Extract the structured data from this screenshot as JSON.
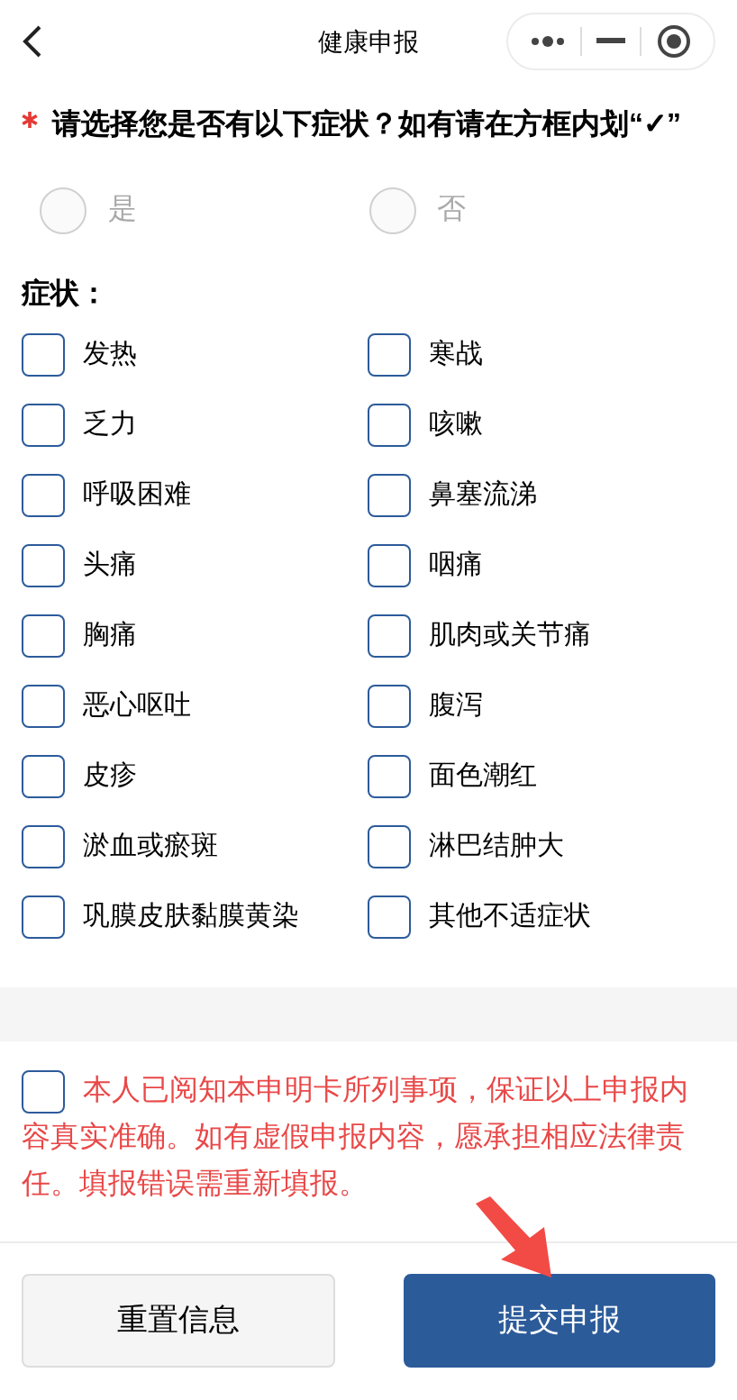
{
  "header": {
    "title": "健康申报"
  },
  "question": {
    "required": true,
    "text": "请选择您是否有以下症状？如有请在方框内划“✓”"
  },
  "options": [
    {
      "label": "是",
      "selected": false
    },
    {
      "label": "否",
      "selected": false
    }
  ],
  "symptoms": {
    "label": "症状：",
    "items": [
      {
        "label": "发热",
        "checked": false
      },
      {
        "label": "寒战",
        "checked": false
      },
      {
        "label": "乏力",
        "checked": false
      },
      {
        "label": "咳嗽",
        "checked": false
      },
      {
        "label": "呼吸困难",
        "checked": false
      },
      {
        "label": "鼻塞流涕",
        "checked": false
      },
      {
        "label": "头痛",
        "checked": false
      },
      {
        "label": "咽痛",
        "checked": false
      },
      {
        "label": "胸痛",
        "checked": false
      },
      {
        "label": "肌肉或关节痛",
        "checked": false
      },
      {
        "label": "恶心呕吐",
        "checked": false
      },
      {
        "label": "腹泻",
        "checked": false
      },
      {
        "label": "皮疹",
        "checked": false
      },
      {
        "label": "面色潮红",
        "checked": false
      },
      {
        "label": "淤血或瘀斑",
        "checked": false
      },
      {
        "label": "淋巴结肿大",
        "checked": false
      },
      {
        "label": "巩膜皮肤黏膜黄染",
        "checked": false
      },
      {
        "label": "其他不适症状",
        "checked": false
      }
    ]
  },
  "declaration": {
    "checked": false,
    "text": "本人已阅知本申明卡所列事项，保证以上申报内容真实准确。如有虚假申报内容，愿承担相应法律责任。填报错误需重新填报。"
  },
  "buttons": [
    {
      "label": "重置信息",
      "kind": "secondary"
    },
    {
      "label": "提交申报",
      "kind": "primary"
    }
  ]
}
